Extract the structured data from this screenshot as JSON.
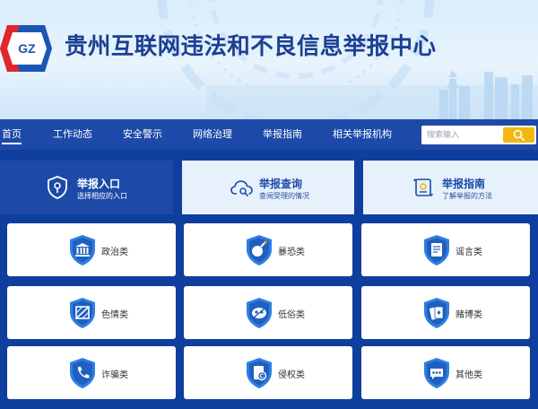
{
  "header": {
    "logo_text": "GZ",
    "title": "贵州互联网违法和不良信息举报中心"
  },
  "nav": {
    "items": [
      "首页",
      "工作动态",
      "安全警示",
      "网络治理",
      "举报指南",
      "相关举报机构"
    ],
    "active": "首页"
  },
  "search": {
    "placeholder": "搜索输入"
  },
  "tabs": [
    {
      "title": "举报入口",
      "subtitle": "选择相应的入口",
      "icon": "shield-lock-icon",
      "active": true
    },
    {
      "title": "举报查询",
      "subtitle": "查阅受理的情况",
      "icon": "cloud-search-icon",
      "active": false
    },
    {
      "title": "举报指南",
      "subtitle": "了解举报的方法",
      "icon": "scroll-icon",
      "active": false
    }
  ],
  "categories": [
    {
      "label": "政治类",
      "icon": "building-icon"
    },
    {
      "label": "暴恐类",
      "icon": "bomb-icon"
    },
    {
      "label": "谣言类",
      "icon": "document-icon"
    },
    {
      "label": "色情类",
      "icon": "blocked-image-icon"
    },
    {
      "label": "低俗类",
      "icon": "mask-icon"
    },
    {
      "label": "赌博类",
      "icon": "cards-icon"
    },
    {
      "label": "诈骗类",
      "icon": "phone-icon"
    },
    {
      "label": "侵权类",
      "icon": "copyright-icon"
    },
    {
      "label": "其他类",
      "icon": "more-icon"
    }
  ],
  "colors": {
    "primary": "#1d4aa9",
    "background": "#0f3f9e",
    "accent": "#f3b712",
    "tab_inactive": "#e6f1fc"
  }
}
